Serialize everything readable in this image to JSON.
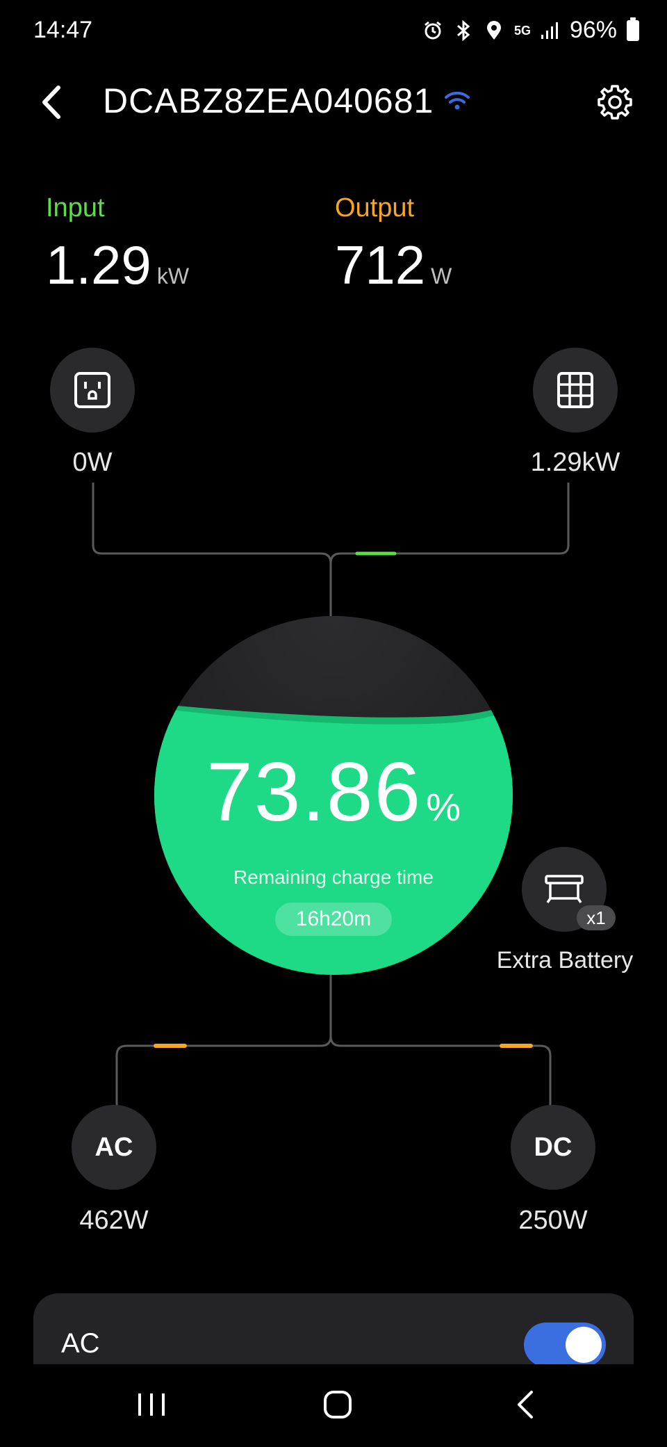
{
  "status_bar": {
    "time": "14:47",
    "network": "5G",
    "battery": "96%"
  },
  "header": {
    "device_name": "DCABZ8ZEA040681",
    "wifi_icon": "wifi-icon",
    "back_icon": "back-arrow-icon",
    "settings_icon": "gear-icon"
  },
  "summary": {
    "input_label": "Input",
    "input_value": "1.29",
    "input_unit": "kW",
    "output_label": "Output",
    "output_value": "712",
    "output_unit": "W"
  },
  "sources": {
    "ac_input_icon": "outlet-icon",
    "ac_input_value": "0W",
    "solar_icon": "solar-panel-icon",
    "solar_value": "1.29kW"
  },
  "battery": {
    "percent": "73.86",
    "percent_symbol": "%",
    "level_fraction": 0.7386,
    "remaining_label": "Remaining charge time",
    "remaining_value": "16h20m",
    "extra_battery_label": "Extra Battery",
    "extra_battery_count": "x1"
  },
  "outputs": {
    "ac_label": "AC",
    "ac_value": "462W",
    "dc_label": "DC",
    "dc_value": "250W"
  },
  "card": {
    "title": "AC",
    "toggle_on": true
  },
  "colors": {
    "input_green": "#5fdc4a",
    "output_orange": "#f5a623",
    "battery_green": "#1ed985",
    "toggle_blue": "#3b6fe0"
  }
}
